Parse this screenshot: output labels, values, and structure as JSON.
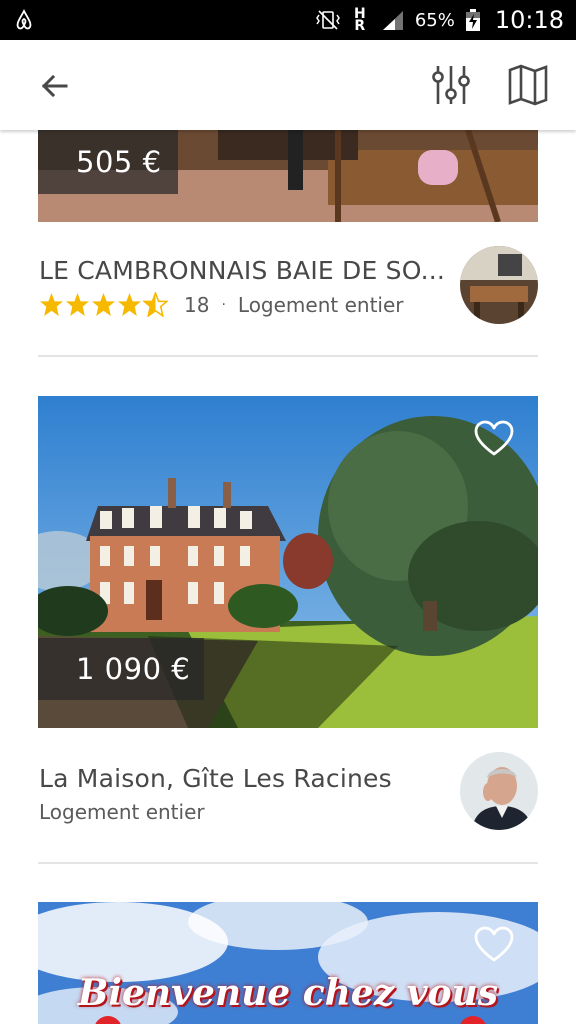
{
  "status_bar": {
    "app_icon": "airbnb-logo-icon",
    "network_top": "H",
    "network_mid": "R",
    "battery": "65%",
    "time": "10:18"
  },
  "app_bar": {
    "back_icon": "arrow-left-icon",
    "filter_icon": "sliders-icon",
    "map_icon": "map-icon"
  },
  "listings": [
    {
      "price": "505 €",
      "title": "LE CAMBRONNAIS  BAIE DE SO...",
      "rating_stars": 4.5,
      "review_count": "18",
      "separator": "·",
      "type": "Logement entier"
    },
    {
      "price": "1 090 €",
      "title": "La Maison, Gîte Les Racines",
      "type": "Logement entier",
      "favorite": false
    },
    {
      "photo_caption": "Bienvenue chez vous",
      "favorite": false
    }
  ],
  "colors": {
    "star": "#f6b900",
    "text": "#484848",
    "divider": "#e4e4e4"
  }
}
